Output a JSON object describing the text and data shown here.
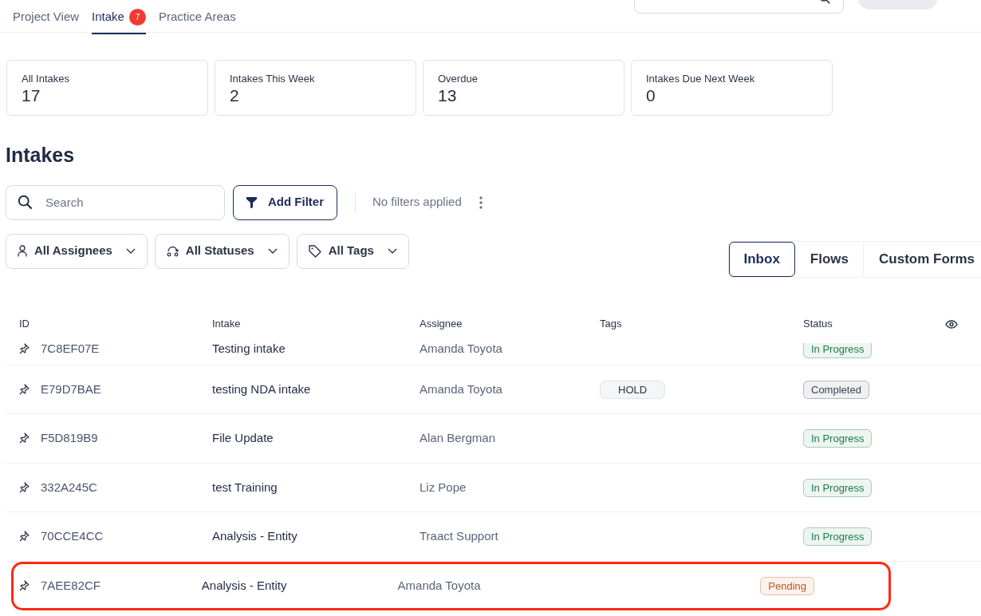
{
  "nav_tabs": [
    {
      "label": "Project View",
      "selected": false
    },
    {
      "label": "Intake",
      "selected": true,
      "count": "7"
    },
    {
      "label": "Practice Areas",
      "selected": false
    }
  ],
  "stats": [
    {
      "label": "All Intakes",
      "value": "17"
    },
    {
      "label": "Intakes This Week",
      "value": "2"
    },
    {
      "label": "Overdue",
      "value": "13"
    },
    {
      "label": "Intakes Due Next Week",
      "value": "0"
    }
  ],
  "heading": "Intakes",
  "search": {
    "placeholder": "Search"
  },
  "add_filter": "Add Filter",
  "filter_status": "No filters applied",
  "dropdowns": [
    {
      "kind": "person",
      "label": "All Assignees"
    },
    {
      "kind": "status",
      "label": "All Statuses"
    },
    {
      "kind": "tag",
      "label": "All Tags"
    }
  ],
  "views": [
    {
      "label": "Inbox",
      "selected": true
    },
    {
      "label": "Flows",
      "selected": false
    },
    {
      "label": "Custom Forms",
      "selected": false
    }
  ],
  "table": {
    "columns": [
      "ID",
      "Intake",
      "Assignee",
      "Tags",
      "Status"
    ],
    "rows": [
      {
        "id": "7C8EF07E",
        "intake": "Testing intake",
        "assignee": "Amanda Toyota",
        "tag": null,
        "status": "In Progress",
        "color": "#1e7a4a",
        "highlighted": false
      },
      {
        "id": "E79D7BAE",
        "intake": "testing NDA intake",
        "assignee": "Amanda Toyota",
        "tag": "HOLD",
        "status": "Completed",
        "color": "#3b4458",
        "highlighted": false
      },
      {
        "id": "F5D819B9",
        "intake": "File Update",
        "assignee": "Alan Bergman",
        "tag": null,
        "status": "In Progress",
        "color": "#1e7a4a",
        "highlighted": false
      },
      {
        "id": "332A245C",
        "intake": "test Training",
        "assignee": "Liz Pope",
        "tag": null,
        "status": "In Progress",
        "color": "#1e7a4a",
        "highlighted": false
      },
      {
        "id": "70CCE4CC",
        "intake": "Analysis - Entity",
        "assignee": "Traact Support",
        "tag": null,
        "status": "In Progress",
        "color": "#1e7a4a",
        "highlighted": false
      },
      {
        "id": "7AEE82CF",
        "intake": "Analysis - Entity",
        "assignee": "Amanda Toyota",
        "tag": null,
        "status": "Pending",
        "color": "#c4581a",
        "highlighted": true
      }
    ]
  }
}
